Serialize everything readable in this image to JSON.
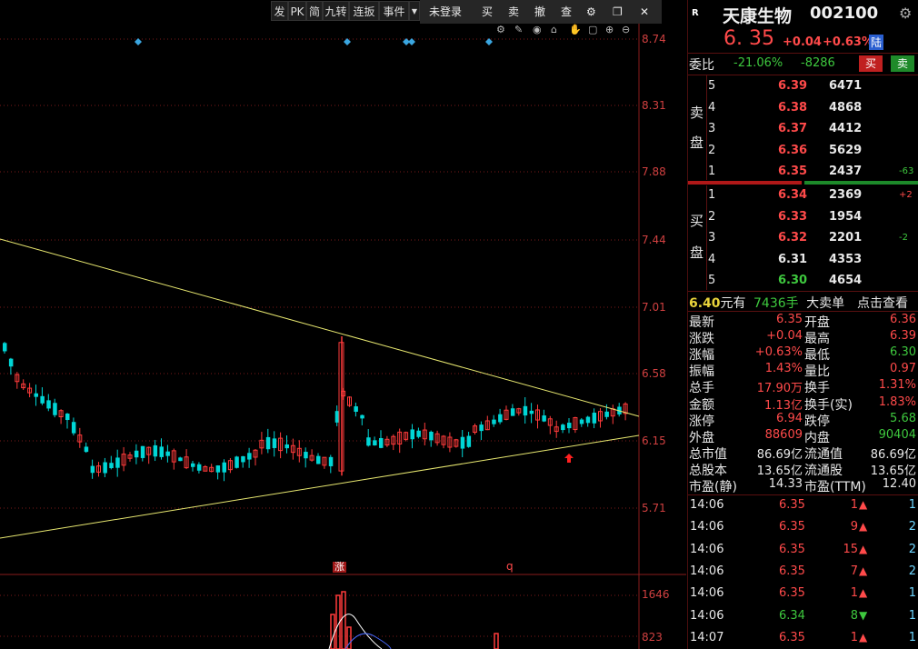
{
  "toolbar": {
    "buttons": [
      "发",
      "PK",
      "简",
      "九转",
      "连扳",
      "事件"
    ],
    "login": "未登录",
    "buy": "买",
    "sell": "卖",
    "cancel": "撤",
    "query": "查"
  },
  "price_axis": [
    "8.74",
    "8.31",
    "7.88",
    "7.44",
    "7.01",
    "6.58",
    "6.15",
    "5.71"
  ],
  "volume_axis": [
    "1646",
    "823"
  ],
  "markers": {
    "limit_up": "涨",
    "q": "q"
  },
  "stock": {
    "badge": "R",
    "name": "天康生物",
    "code": "002100",
    "price": "6. 35",
    "change": "+0.04",
    "change_pct": "+0.63%",
    "market": "陆"
  },
  "weibi": {
    "label": "委比",
    "pct": "-21.06%",
    "diff": "-8286",
    "buy_btn": "买",
    "sell_btn": "卖"
  },
  "ask_label": [
    "卖",
    "盘"
  ],
  "bid_label": [
    "买",
    "盘"
  ],
  "asks": [
    {
      "level": "5",
      "price": "6.39",
      "vol": "6471",
      "chg": ""
    },
    {
      "level": "4",
      "price": "6.38",
      "vol": "4868",
      "chg": ""
    },
    {
      "level": "3",
      "price": "6.37",
      "vol": "4412",
      "chg": ""
    },
    {
      "level": "2",
      "price": "6.36",
      "vol": "5629",
      "chg": ""
    },
    {
      "level": "1",
      "price": "6.35",
      "vol": "2437",
      "chg": "-63"
    }
  ],
  "bids": [
    {
      "level": "1",
      "price": "6.34",
      "vol": "2369",
      "chg": "+2"
    },
    {
      "level": "2",
      "price": "6.33",
      "vol": "1954",
      "chg": ""
    },
    {
      "level": "3",
      "price": "6.32",
      "vol": "2201",
      "chg": "-2"
    },
    {
      "level": "4",
      "price": "6.31",
      "vol": "4353",
      "chg": ""
    },
    {
      "level": "5",
      "price": "6.30",
      "vol": "4654",
      "chg": ""
    }
  ],
  "big_order": {
    "price": "6.40",
    "text1": "元有",
    "qty": "7436手",
    "text2": "大卖单",
    "link": "点击查看"
  },
  "stats": [
    {
      "l1": "最新",
      "v1": "6.35",
      "l2": "开盘",
      "v2": "6.36"
    },
    {
      "l1": "涨跌",
      "v1": "+0.04",
      "l2": "最高",
      "v2": "6.39"
    },
    {
      "l1": "涨幅",
      "v1": "+0.63%",
      "l2": "最低",
      "v2": "6.30"
    },
    {
      "l1": "振幅",
      "v1": "1.43%",
      "l2": "量比",
      "v2": "0.97"
    },
    {
      "l1": "总手",
      "v1": "17.90万",
      "l2": "换手",
      "v2": "1.31%"
    },
    {
      "l1": "金额",
      "v1": "1.13亿",
      "l2": "换手(实)",
      "v2": "1.83%"
    },
    {
      "l1": "涨停",
      "v1": "6.94",
      "l2": "跌停",
      "v2": "5.68"
    },
    {
      "l1": "外盘",
      "v1": "88609",
      "l2": "内盘",
      "v2": "90404"
    },
    {
      "l1": "总市值",
      "v1": "86.69亿",
      "l2": "流通值",
      "v2": "86.69亿"
    },
    {
      "l1": "总股本",
      "v1": "13.65亿",
      "l2": "流通股",
      "v2": "13.65亿"
    },
    {
      "l1": "市盈(静)",
      "v1": "14.33",
      "l2": "市盈(TTM)",
      "v2": "12.40"
    }
  ],
  "ticks": [
    {
      "time": "14:06",
      "price": "6.35",
      "vol": "1",
      "dir": "up",
      "num": "1"
    },
    {
      "time": "14:06",
      "price": "6.35",
      "vol": "9",
      "dir": "up",
      "num": "2"
    },
    {
      "time": "14:06",
      "price": "6.35",
      "vol": "15",
      "dir": "up",
      "num": "2"
    },
    {
      "time": "14:06",
      "price": "6.35",
      "vol": "7",
      "dir": "up",
      "num": "2"
    },
    {
      "time": "14:06",
      "price": "6.35",
      "vol": "1",
      "dir": "up",
      "num": "1"
    },
    {
      "time": "14:06",
      "price": "6.34",
      "vol": "8",
      "dir": "down",
      "num": "1"
    },
    {
      "time": "14:07",
      "price": "6.35",
      "vol": "1",
      "dir": "up",
      "num": "1"
    }
  ],
  "colors": {
    "up": "#ff3b3b",
    "down": "#00d6d6",
    "trendline": "#e8e870",
    "grid": "#7a1a1a"
  }
}
